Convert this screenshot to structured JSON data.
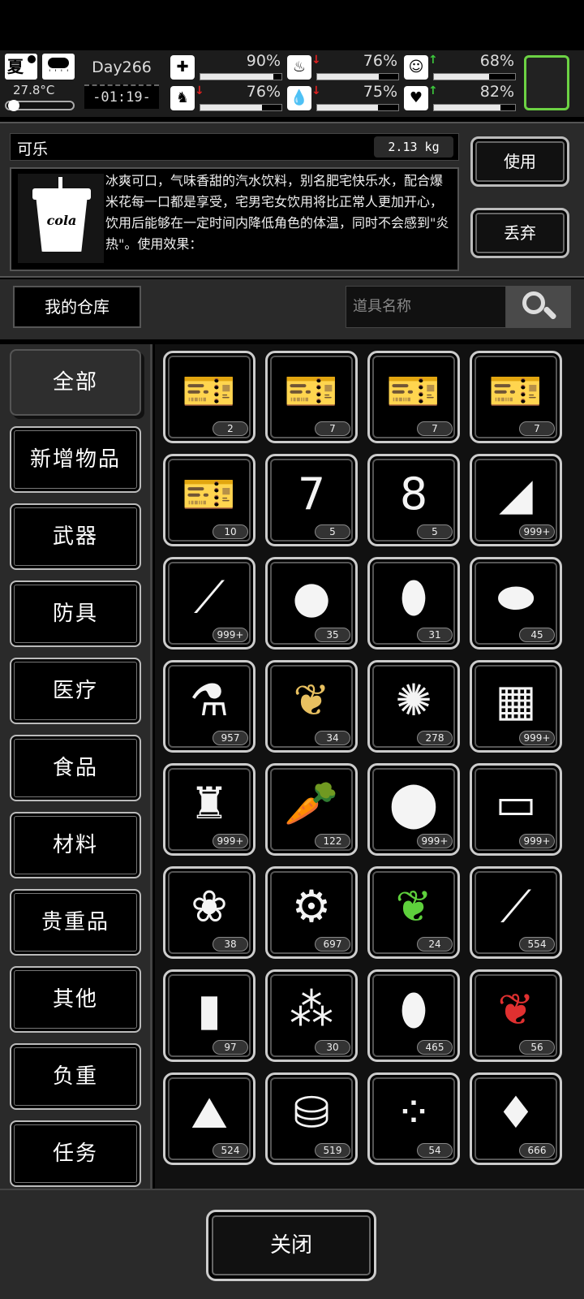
{
  "hud": {
    "season": "夏",
    "weather_icon": "rain-cloud-icon",
    "temperature": "27.8°C",
    "temperature_level": 0.05,
    "day": "Day266",
    "time": "-01:19-",
    "stats": [
      {
        "name": "health",
        "icon": "medkit-icon",
        "glyph": "✚",
        "value": "90%",
        "level": 0.9,
        "arrow": "",
        "arrow_color": "#ffffff"
      },
      {
        "name": "hunger",
        "icon": "stomach-icon",
        "glyph": "♨",
        "value": "76%",
        "level": 0.76,
        "arrow": "↓",
        "arrow_color": "#e02020"
      },
      {
        "name": "mood",
        "icon": "face-icon",
        "glyph": "☺",
        "value": "68%",
        "level": 0.68,
        "arrow": "↑",
        "arrow_color": "#3cc83c"
      },
      {
        "name": "stamina",
        "icon": "foot-icon",
        "glyph": "♞",
        "value": "76%",
        "level": 0.76,
        "arrow": "↓",
        "arrow_color": "#e02020"
      },
      {
        "name": "thirst",
        "icon": "water-drop-icon",
        "glyph": "💧",
        "value": "75%",
        "level": 0.75,
        "arrow": "↓",
        "arrow_color": "#e02020"
      },
      {
        "name": "heart",
        "icon": "heart-icon",
        "glyph": "♥",
        "value": "82%",
        "level": 0.82,
        "arrow": "↑",
        "arrow_color": "#3cc83c"
      }
    ],
    "slot_border_color": "#6cd244"
  },
  "detail": {
    "item_name": "可乐",
    "weight": "2.13 kg",
    "image_label": "cola",
    "description": "冰爽可口，气味香甜的汽水饮料，别名肥宅快乐水，配合爆米花每一口都是享受，宅男宅女饮用将比正常人更加开心，饮用后能够在一定时间内降低角色的体温，同时不会感到\"炎热\"。使用效果：",
    "use_label": "使用",
    "discard_label": "丢弃"
  },
  "warehouse": {
    "title": "我的仓库",
    "search_placeholder": "道具名称"
  },
  "categories": [
    "全部",
    "新增物品",
    "武器",
    "防具",
    "医疗",
    "食品",
    "材料",
    "贵重品",
    "其他",
    "负重",
    "任务"
  ],
  "items": [
    {
      "icon": "ticket-icon",
      "glyph": "🎫",
      "count": "2"
    },
    {
      "icon": "ticket-icon",
      "glyph": "🎫",
      "count": "7"
    },
    {
      "icon": "ticket-icon",
      "glyph": "🎫",
      "count": "7"
    },
    {
      "icon": "ticket-icon",
      "glyph": "🎫",
      "count": "7"
    },
    {
      "icon": "ticket-icon",
      "glyph": "🎫",
      "count": "10"
    },
    {
      "icon": "level-7-card-icon",
      "glyph": "7",
      "count": "5"
    },
    {
      "icon": "level-8-card-icon",
      "glyph": "8",
      "count": "5"
    },
    {
      "icon": "cloth-scraps-icon",
      "glyph": "◢",
      "count": "999+"
    },
    {
      "icon": "needles-icon",
      "glyph": "⟋",
      "count": "999+"
    },
    {
      "icon": "chicken-icon",
      "glyph": "●",
      "count": "35"
    },
    {
      "icon": "almonds-icon",
      "glyph": "⬮",
      "count": "31"
    },
    {
      "icon": "beans-icon",
      "glyph": "⬬",
      "count": "45"
    },
    {
      "icon": "spray-bottle-icon",
      "glyph": "⚗",
      "count": "957"
    },
    {
      "icon": "yellow-leaves-icon",
      "glyph": "❦",
      "count": "34",
      "color": "#e8c060"
    },
    {
      "icon": "cotton-icon",
      "glyph": "✺",
      "count": "278"
    },
    {
      "icon": "bricks-icon",
      "glyph": "▦",
      "count": "999+"
    },
    {
      "icon": "rags-icon",
      "glyph": "♜",
      "count": "999+"
    },
    {
      "icon": "carrot-icon",
      "glyph": "🥕",
      "count": "122"
    },
    {
      "icon": "potatoes-icon",
      "glyph": "⬤",
      "count": "999+"
    },
    {
      "icon": "towel-icon",
      "glyph": "▭",
      "count": "999+"
    },
    {
      "icon": "seeds-icon",
      "glyph": "❀",
      "count": "38"
    },
    {
      "icon": "gears-icon",
      "glyph": "⚙",
      "count": "697"
    },
    {
      "icon": "green-leaves-icon",
      "glyph": "❦",
      "count": "24",
      "color": "#5ed03c"
    },
    {
      "icon": "scallion-icon",
      "glyph": "⟋",
      "count": "554"
    },
    {
      "icon": "batteries-icon",
      "glyph": "▮",
      "count": "97"
    },
    {
      "icon": "rice-icon",
      "glyph": "⁂",
      "count": "30"
    },
    {
      "icon": "bullets-icon",
      "glyph": "⬮",
      "count": "465"
    },
    {
      "icon": "red-leaves-icon",
      "glyph": "❦",
      "count": "56",
      "color": "#e03030"
    },
    {
      "icon": "salt-icon",
      "glyph": "⛰",
      "count": "524"
    },
    {
      "icon": "cans-icon",
      "glyph": "⛁",
      "count": "519"
    },
    {
      "icon": "grains-icon",
      "glyph": "⁘",
      "count": "54"
    },
    {
      "icon": "meat-icon",
      "glyph": "♦",
      "count": "666"
    }
  ],
  "footer": {
    "close_label": "关闭"
  }
}
